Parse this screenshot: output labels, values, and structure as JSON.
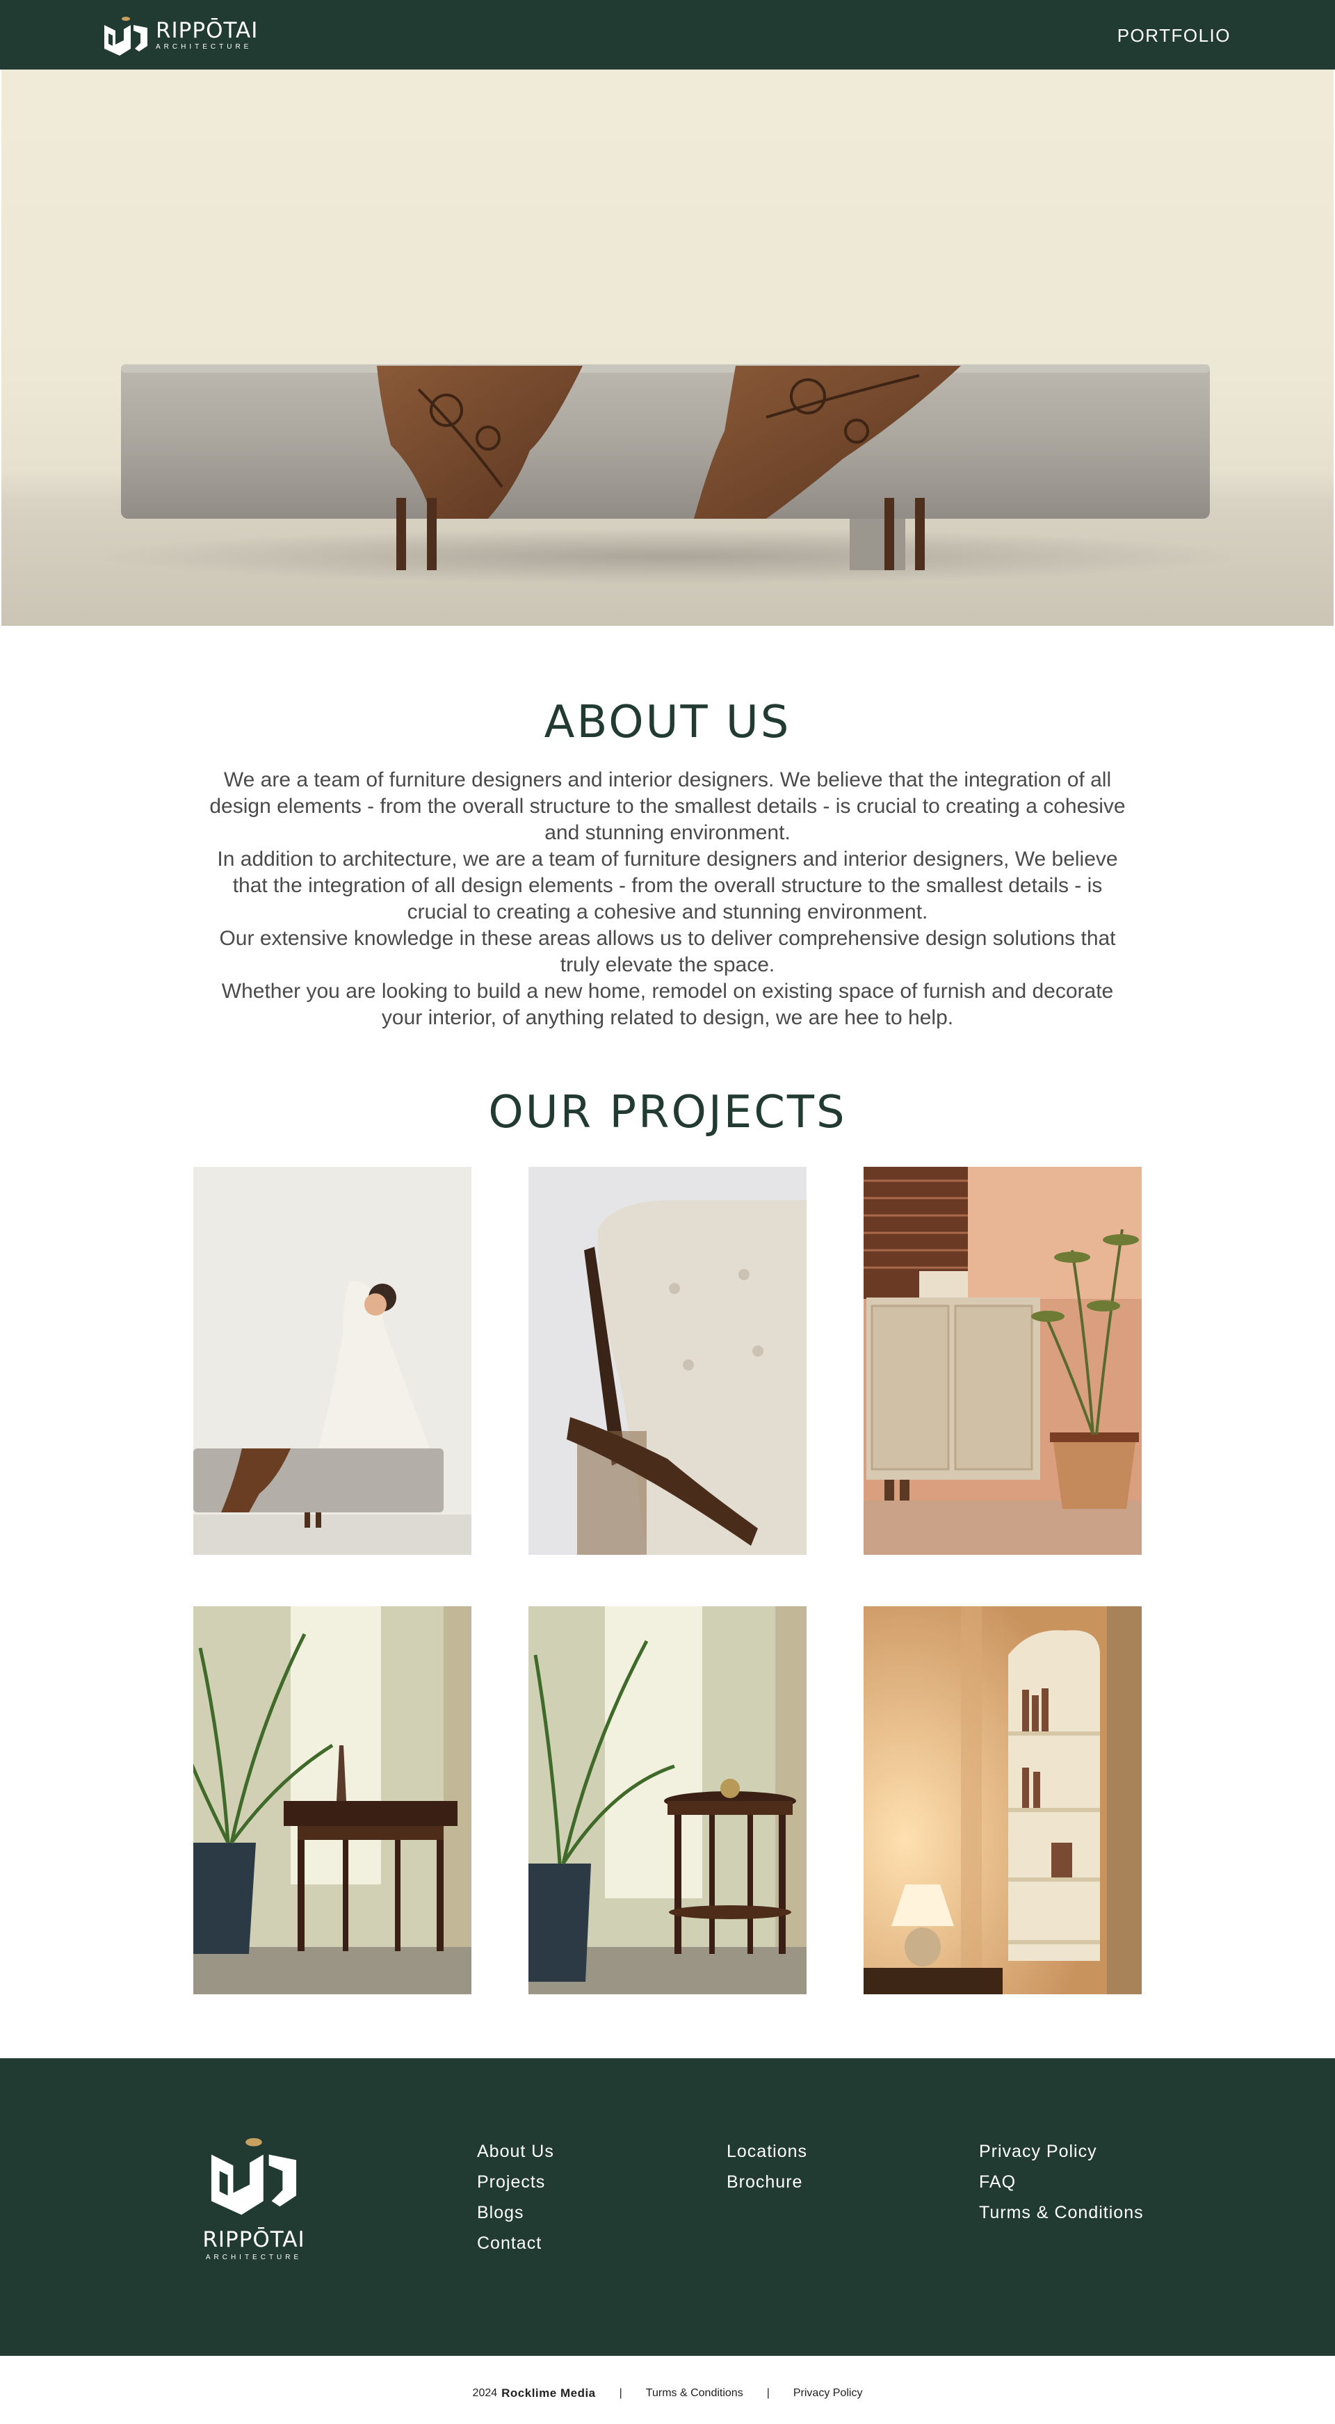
{
  "header": {
    "logo_name": "RIPPŌTAI",
    "logo_sub": "ARCHITECTURE",
    "nav_portfolio": "PORTFOLIO"
  },
  "about": {
    "title": "ABOUT US",
    "paragraphs": [
      "We are a team of furniture designers and interior designers. We believe that the integration of all design elements - from the overall structure to the smallest details - is crucial to creating a cohesive and stunning environment.",
      "In addition to architecture, we are a team of furniture designers and  interior designers, We believe that the integration of all design elements - from the overall structure to the smallest details - is crucial to creating a cohesive and stunning environment.",
      "Our extensive knowledge in these areas allows us to deliver comprehensive design solutions that truly elevate the space.",
      "Whether you are looking to build a new home, remodel on existing space of furnish and decorate your interior, of anything related to design, we are hee to help."
    ]
  },
  "projects": {
    "title": "OUR PROJECTS"
  },
  "footer": {
    "logo_name": "RIPPŌTAI",
    "logo_sub": "ARCHITECTURE",
    "col1": [
      "About Us",
      "Projects",
      "Blogs",
      "Contact"
    ],
    "col2": [
      "Locations",
      "Brochure"
    ],
    "col3": [
      "Privacy Policy",
      "FAQ",
      "Turms & Conditions"
    ]
  },
  "bottom": {
    "year": "2024",
    "brand": "Rocklime Media",
    "sep": "|",
    "terms": "Turms & Conditions",
    "privacy": "Privacy Policy"
  },
  "colors": {
    "brand_green": "#213a32",
    "text_gray": "#4a4a4a",
    "gold_accent": "#c8a060"
  }
}
